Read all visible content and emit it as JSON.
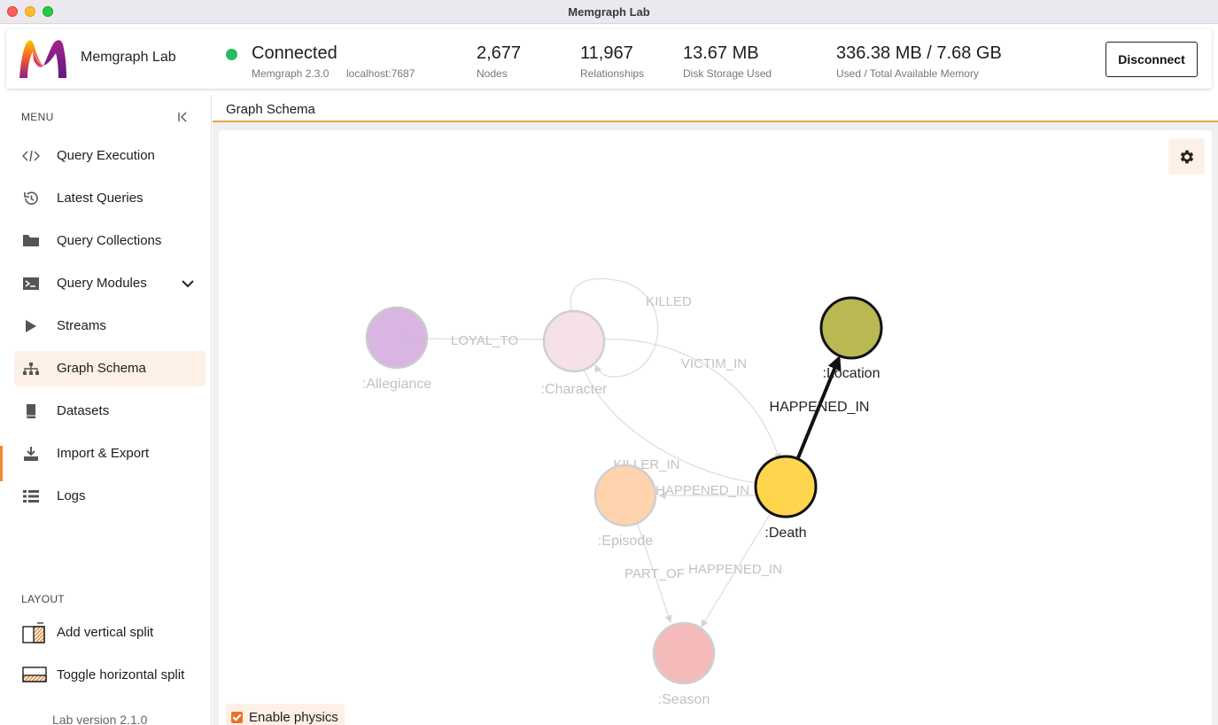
{
  "window": {
    "title": "Memgraph Lab"
  },
  "header": {
    "app_name": "Memgraph Lab",
    "status": "Connected",
    "version": "Memgraph 2.3.0",
    "host": "localhost:7687",
    "stats": [
      {
        "value": "2,677",
        "label": "Nodes"
      },
      {
        "value": "11,967",
        "label": "Relationships"
      },
      {
        "value": "13.67 MB",
        "label": "Disk Storage Used"
      },
      {
        "value": "336.38 MB / 7.68 GB",
        "label": "Used / Total Available Memory"
      }
    ],
    "disconnect_label": "Disconnect",
    "status_color": "#29b962"
  },
  "sidebar": {
    "menu_label": "MENU",
    "items": [
      {
        "label": "Query Execution",
        "icon": "code-icon"
      },
      {
        "label": "Latest Queries",
        "icon": "history-icon"
      },
      {
        "label": "Query Collections",
        "icon": "folder-icon"
      },
      {
        "label": "Query Modules",
        "icon": "terminal-icon"
      },
      {
        "label": "Streams",
        "icon": "play-icon"
      },
      {
        "label": "Graph Schema",
        "icon": "sitemap-icon",
        "active": true
      },
      {
        "label": "Datasets",
        "icon": "book-icon"
      },
      {
        "label": "Import & Export",
        "icon": "download-icon"
      },
      {
        "label": "Logs",
        "icon": "list-icon"
      }
    ],
    "layout_label": "LAYOUT",
    "layout_items": [
      {
        "label": "Add vertical split",
        "icon": "vertical-split-icon"
      },
      {
        "label": "Toggle horizontal split",
        "icon": "horizontal-split-icon"
      }
    ],
    "lab_version": "Lab version 2.1.0",
    "accent_color": "#f28a2e"
  },
  "main": {
    "tab_title": "Graph Schema",
    "enable_physics_label": "Enable physics",
    "enable_physics_checked": true
  },
  "graph": {
    "nodes": [
      {
        "label": ":Allegiance",
        "color": "#d6b3e0",
        "faded": true
      },
      {
        "label": ":Character",
        "color": "#f5dce3",
        "faded": true
      },
      {
        "label": ":Location",
        "color": "#b9b954",
        "faded": false
      },
      {
        "label": ":Death",
        "color": "#ffd54d",
        "faded": false
      },
      {
        "label": ":Episode",
        "color": "#ffcfa6",
        "faded": true
      },
      {
        "label": ":Season",
        "color": "#f4b6b6",
        "faded": true
      }
    ],
    "edges": [
      {
        "label": "LOYAL_TO"
      },
      {
        "label": "KILLED"
      },
      {
        "label": "VICTIM_IN"
      },
      {
        "label": "HAPPENED_IN"
      },
      {
        "label": "KILLER_IN"
      },
      {
        "label": "HAPPENED_IN"
      },
      {
        "label": "PART_OF"
      },
      {
        "label": "HAPPENED_IN"
      }
    ]
  }
}
